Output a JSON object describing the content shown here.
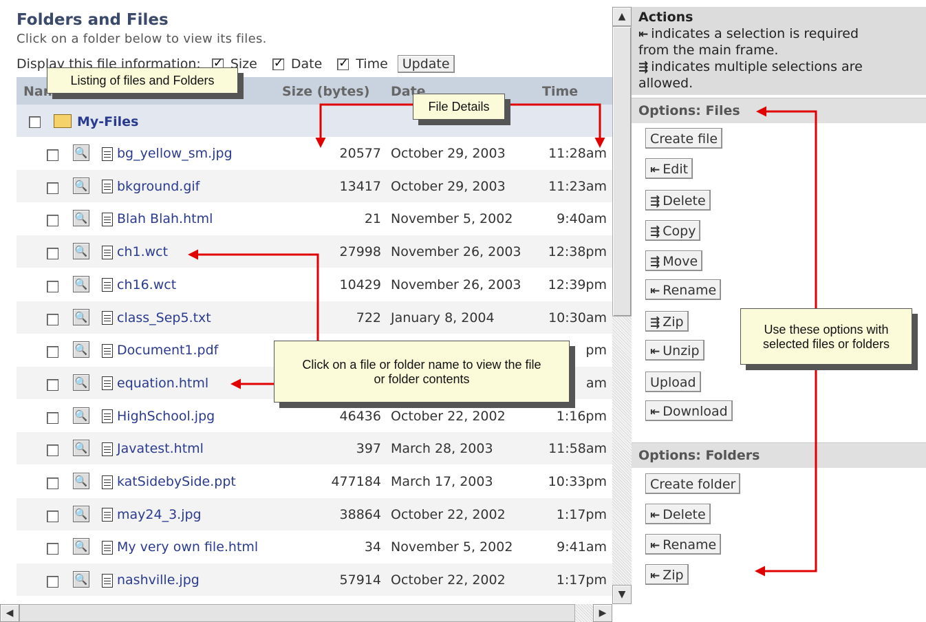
{
  "header": {
    "title": "Folders and Files",
    "subtitle": "Click on a folder below to view its files.",
    "display_label": "Display this file information:",
    "options": [
      "Size",
      "Date",
      "Time"
    ],
    "update_label": "Update"
  },
  "table": {
    "columns": [
      "Name",
      "Size (bytes)",
      "Date",
      "Time"
    ],
    "folder": "My-Files",
    "rows": [
      {
        "name": "bg_yellow_sm.jpg",
        "size": "20577",
        "date": "October 29, 2003",
        "time": "11:28am"
      },
      {
        "name": "bkground.gif",
        "size": "13417",
        "date": "October 29, 2003",
        "time": "11:23am"
      },
      {
        "name": "Blah Blah.html",
        "size": "21",
        "date": "November 5, 2002",
        "time": "9:40am"
      },
      {
        "name": "ch1.wct",
        "size": "27998",
        "date": "November 26, 2003",
        "time": "12:38pm"
      },
      {
        "name": "ch16.wct",
        "size": "10429",
        "date": "November 26, 2003",
        "time": "12:39pm"
      },
      {
        "name": "class_Sep5.txt",
        "size": "722",
        "date": "January 8, 2004",
        "time": "10:30am"
      },
      {
        "name": "Document1.pdf",
        "size": "",
        "date": "",
        "time": "pm"
      },
      {
        "name": "equation.html",
        "size": "",
        "date": "",
        "time": "am"
      },
      {
        "name": "HighSchool.jpg",
        "size": "46436",
        "date": "October 22, 2002",
        "time": "1:16pm"
      },
      {
        "name": "Javatest.html",
        "size": "397",
        "date": "March 28, 2003",
        "time": "11:58am"
      },
      {
        "name": "katSidebySide.ppt",
        "size": "477184",
        "date": "March 17, 2003",
        "time": "10:33pm"
      },
      {
        "name": "may24_3.jpg",
        "size": "38864",
        "date": "October 22, 2002",
        "time": "1:17pm"
      },
      {
        "name": "My very own file.html",
        "size": "34",
        "date": "November 5, 2002",
        "time": "9:41am"
      },
      {
        "name": "nashville.jpg",
        "size": "57914",
        "date": "October 22, 2002",
        "time": "1:17pm"
      }
    ]
  },
  "actions": {
    "title": "Actions",
    "line1": "indicates a selection is required",
    "line2": "from the main frame.",
    "line3": "indicates multiple selections are",
    "line4": "allowed."
  },
  "files_section": {
    "title": "Options: Files",
    "buttons": [
      "Create file",
      "Edit",
      "Delete",
      "Copy",
      "Move",
      "Rename",
      "Zip",
      "Unzip",
      "Upload",
      "Download"
    ]
  },
  "folders_section": {
    "title": "Options: Folders",
    "buttons": [
      "Create folder",
      "Delete",
      "Rename",
      "Zip"
    ]
  },
  "callouts": {
    "listing": "Listing of files and Folders",
    "details": "File Details",
    "click_line1": "Click on a file or folder name to view the file",
    "click_line2": "or folder contents",
    "options_line1": "Use these options with",
    "options_line2": "selected files or folders"
  },
  "colors": {
    "header_bg": "#c9d3e0",
    "link": "#2a3b8f",
    "callout_bg": "#fbfbd9",
    "arrow": "#e00000"
  }
}
